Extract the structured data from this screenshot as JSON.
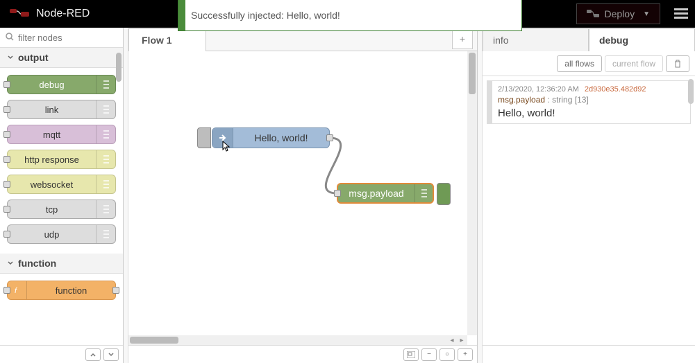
{
  "header": {
    "app_name": "Node-RED",
    "deploy_label": "Deploy"
  },
  "toast": {
    "message": "Successfully injected: Hello, world!"
  },
  "palette": {
    "filter_placeholder": "filter nodes",
    "categories": [
      {
        "name": "output",
        "items": [
          {
            "label": "debug",
            "kind": "debug"
          },
          {
            "label": "link",
            "kind": "link"
          },
          {
            "label": "mqtt",
            "kind": "mqtt"
          },
          {
            "label": "http response",
            "kind": "http"
          },
          {
            "label": "websocket",
            "kind": "ws"
          },
          {
            "label": "tcp",
            "kind": "tcp"
          },
          {
            "label": "udp",
            "kind": "udp"
          }
        ]
      },
      {
        "name": "function",
        "items": [
          {
            "label": "function",
            "kind": "function"
          }
        ]
      }
    ]
  },
  "workspace": {
    "tabs": [
      {
        "label": "Flow 1",
        "active": true
      }
    ],
    "nodes": {
      "inject": {
        "label": "Hello, world!"
      },
      "debug": {
        "label": "msg.payload"
      }
    }
  },
  "sidebar": {
    "tabs": {
      "info": "info",
      "debug": "debug"
    },
    "toolbar": {
      "all_flows": "all flows",
      "current_flow": "current flow"
    },
    "debug_messages": [
      {
        "timestamp": "2/13/2020, 12:36:20 AM",
        "node_id": "2d930e35.482d92",
        "topic": "msg.payload",
        "type_label": "string [13]",
        "value": "Hello, world!"
      }
    ]
  }
}
